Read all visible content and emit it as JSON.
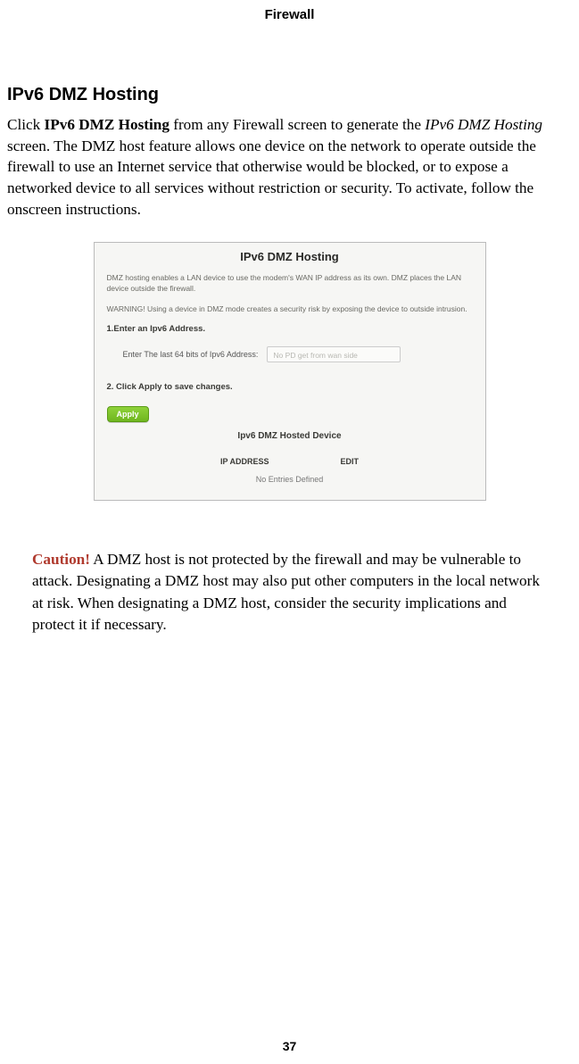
{
  "header": {
    "title": "Firewall"
  },
  "section": {
    "heading": "IPv6 DMZ Hosting",
    "para_pre": "Click ",
    "para_bold": "IPv6 DMZ Hosting",
    "para_mid": " from any Firewall screen to generate the ",
    "para_ital": "IPv6 DMZ Hosting",
    "para_post": " screen. The DMZ host feature allows one device on the network to operate outside the firewall to use an Internet service that otherwise would be blocked, or to expose a networked device to all services without restriction or security. To activate, follow the onscreen instructions."
  },
  "panel": {
    "title": "IPv6 DMZ Hosting",
    "desc1": "DMZ hosting enables a LAN device to use the modem's WAN IP address as its own. DMZ places the LAN device outside the firewall.",
    "desc2": "WARNING! Using a device in DMZ mode creates a security risk by exposing the device to outside intrusion.",
    "step1": "1.Enter an Ipv6 Address.",
    "field_label": "Enter The last 64 bits of Ipv6 Address:",
    "field_placeholder": "No PD get from wan side",
    "step2": "2. Click Apply to save changes.",
    "apply": "Apply",
    "subhead": "Ipv6 DMZ Hosted Device",
    "col_ip": "IP ADDRESS",
    "col_edit": "EDIT",
    "empty": "No Entries Defined"
  },
  "caution": {
    "label": "Caution!",
    "text": " A DMZ host is not protected by the firewall and may be vulnerable to attack. Designating a DMZ host may also put other computers in the local network at risk. When designating a DMZ host, consider the security implications and protect it if necessary."
  },
  "page_number": "37"
}
